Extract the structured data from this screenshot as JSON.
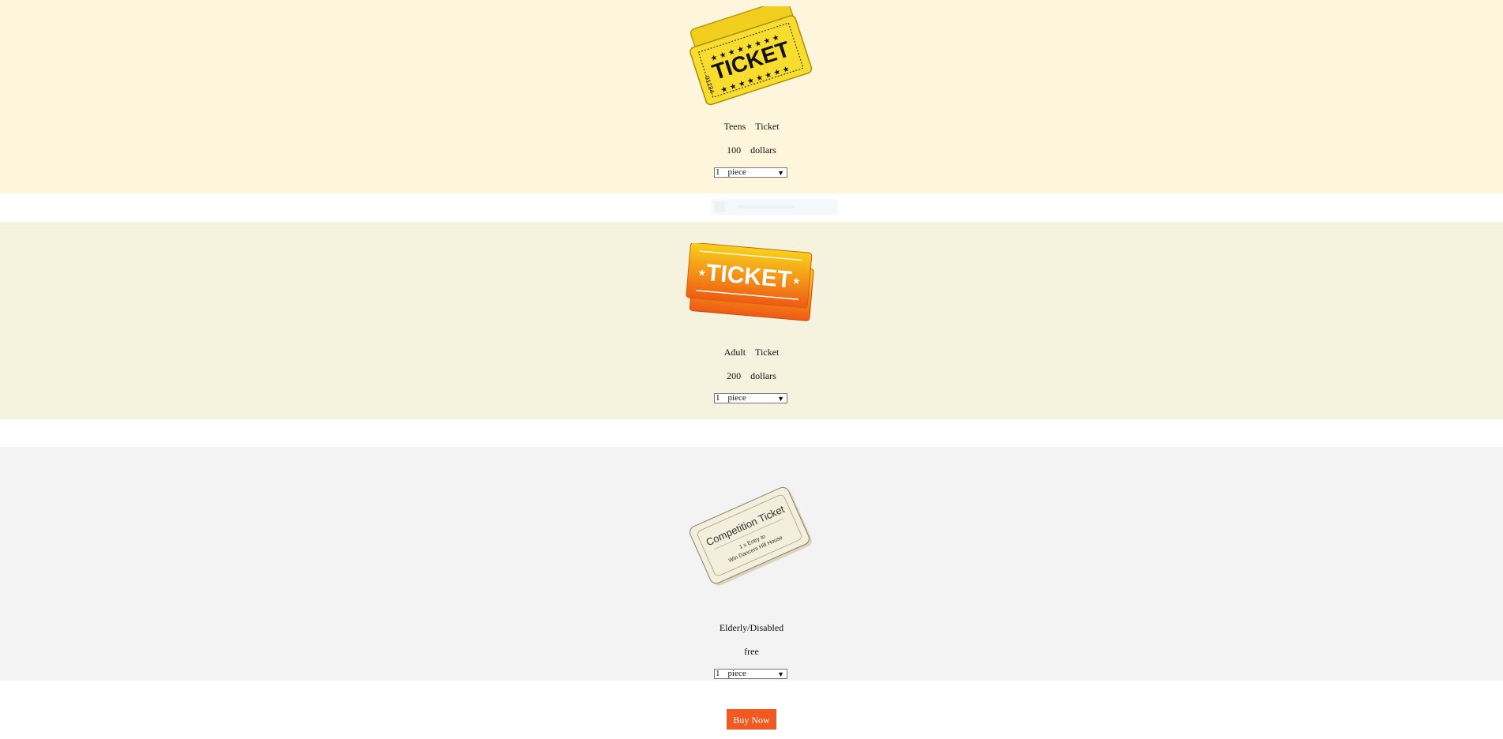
{
  "tickets": [
    {
      "name_words": [
        "Teens",
        "Ticket"
      ],
      "price_words": [
        "100",
        "dollars"
      ],
      "quantity": [
        "1",
        "piece"
      ],
      "image_text": "TICKET",
      "serial": "01234"
    },
    {
      "name_words": [
        "Adult",
        "Ticket"
      ],
      "price_words": [
        "200",
        "dollars"
      ],
      "quantity": [
        "1",
        "piece"
      ],
      "image_text": "TICKET"
    },
    {
      "name_words": [
        "Elderly/Disabled"
      ],
      "price_words": [
        "free"
      ],
      "quantity": [
        "1",
        "piece"
      ],
      "image_title": "Competition Ticket",
      "image_line1": "1 x Entry to",
      "image_line2": "Win Dancers Hill House"
    }
  ],
  "buy_label": "Buy Now",
  "colors": {
    "teens_band": "#fdf6dc",
    "adult_band": "#f5f3de",
    "elder_band": "#f3f3f3",
    "buy_button": "#f05a22"
  },
  "icons": {
    "dropdown": "triangle-down"
  }
}
